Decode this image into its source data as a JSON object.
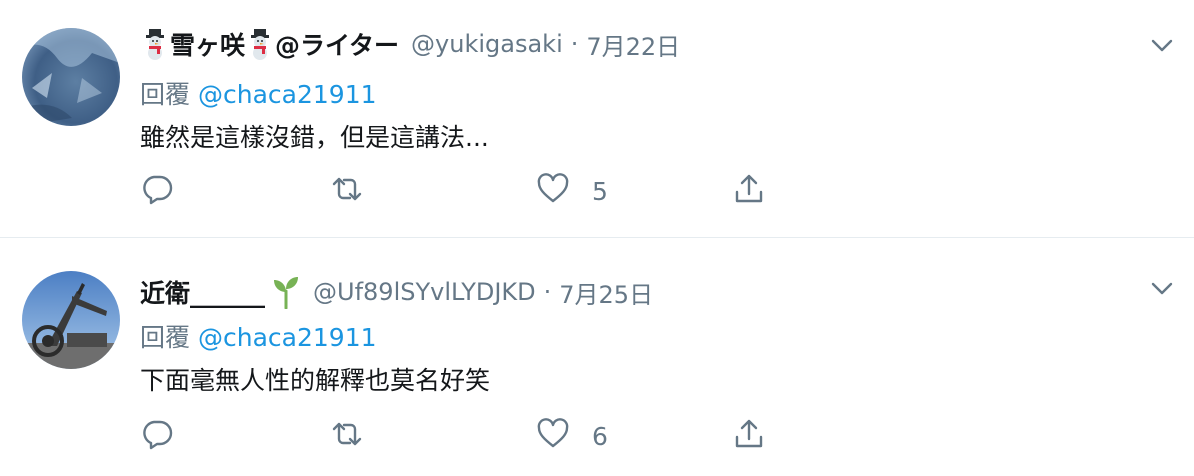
{
  "tweets": [
    {
      "display_name_main": "雪ヶ咲",
      "display_name_suffix": "@ライター",
      "handle": "@yukigasaki",
      "separator": "·",
      "date": "7月22日",
      "reply_label": "回覆",
      "reply_to": "@chaca21911",
      "text": "雖然是這樣沒錯，但是這講法...",
      "like_count": "5",
      "name_emoji": "snowman-icon"
    },
    {
      "display_name_main": "近衛______",
      "handle": "@Uf89lSYvlLYDJKD",
      "separator": "·",
      "date": "7月25日",
      "reply_label": "回覆",
      "reply_to": "@chaca21911",
      "text": "下面毫無人性的解釋也莫名好笑",
      "like_count": "6",
      "name_emoji": "sprout-icon"
    }
  ],
  "colors": {
    "secondary_text": "#657786",
    "mention": "#1b95e0",
    "divider": "#e6ecf0",
    "sprout": "#77b255"
  }
}
